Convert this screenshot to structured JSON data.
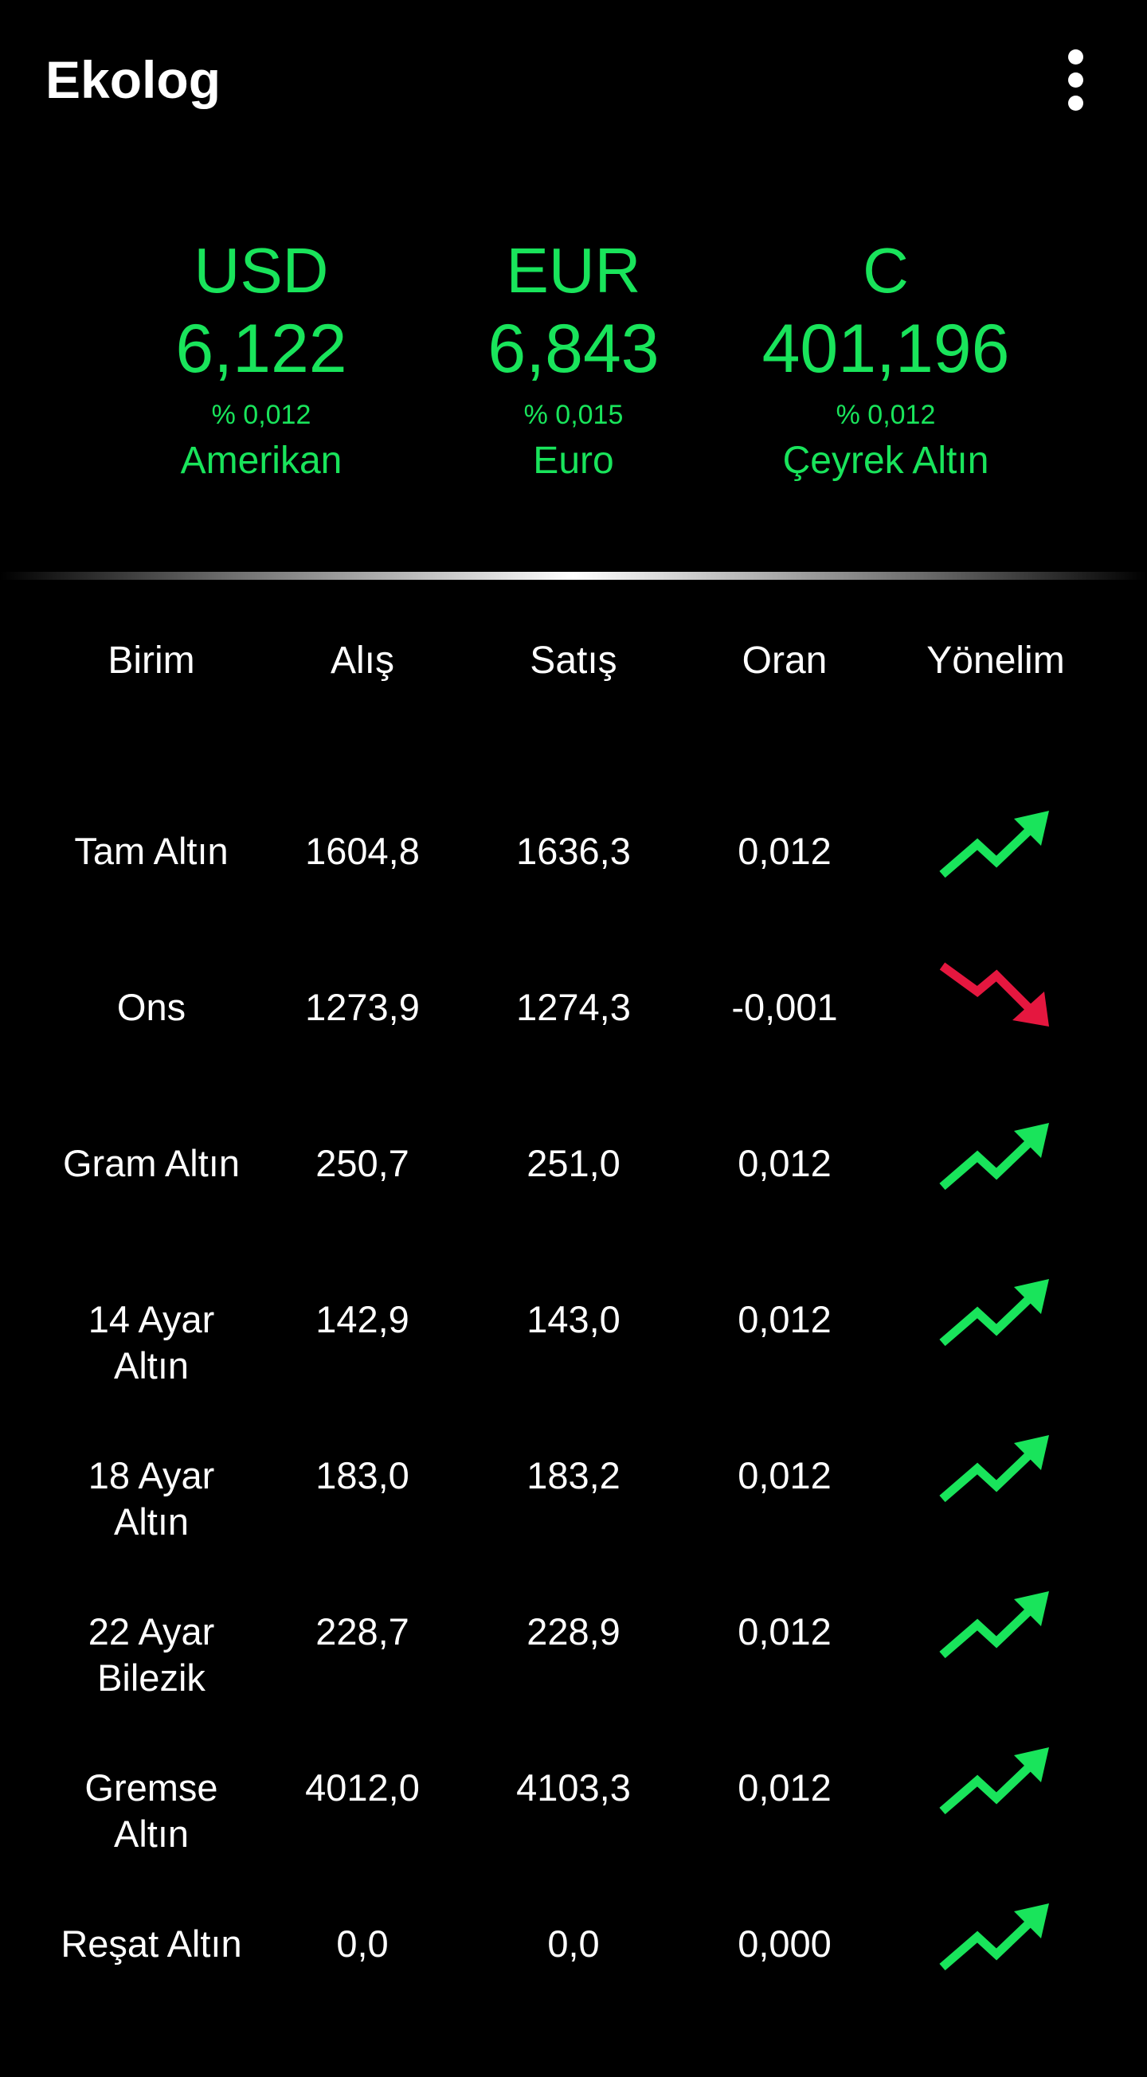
{
  "app": {
    "title": "Ekolog"
  },
  "summary": [
    {
      "code": "USD",
      "value": "6,122",
      "change": "% 0,012",
      "name": "Amerikan"
    },
    {
      "code": "EUR",
      "value": "6,843",
      "change": "% 0,015",
      "name": "Euro"
    },
    {
      "code": "C",
      "value": "401,196",
      "change": "% 0,012",
      "name": "Çeyrek Altın"
    }
  ],
  "colors": {
    "accent_green": "#19e45b",
    "down_red": "#e5173f"
  },
  "table": {
    "headers": [
      "Birim",
      "Alış",
      "Satış",
      "Oran",
      "Yönelim"
    ],
    "rows": [
      {
        "name": "Tam Altın",
        "buy": "1604,8",
        "sell": "1636,3",
        "rate": "0,012",
        "trend": "up"
      },
      {
        "name": "Ons",
        "buy": "1273,9",
        "sell": "1274,3",
        "rate": "-0,001",
        "trend": "down"
      },
      {
        "name": "Gram Altın",
        "buy": "250,7",
        "sell": "251,0",
        "rate": "0,012",
        "trend": "up"
      },
      {
        "name": "14 Ayar\nAltın",
        "buy": "142,9",
        "sell": "143,0",
        "rate": "0,012",
        "trend": "up"
      },
      {
        "name": "18 Ayar\nAltın",
        "buy": "183,0",
        "sell": "183,2",
        "rate": "0,012",
        "trend": "up"
      },
      {
        "name": "22 Ayar\nBilezik",
        "buy": "228,7",
        "sell": "228,9",
        "rate": "0,012",
        "trend": "up"
      },
      {
        "name": "Gremse\nAltın",
        "buy": "4012,0",
        "sell": "4103,3",
        "rate": "0,012",
        "trend": "up"
      },
      {
        "name": "Reşat Altın",
        "buy": "0,0",
        "sell": "0,0",
        "rate": "0,000",
        "trend": "up"
      }
    ]
  },
  "icons": {
    "menu": "overflow-menu-icon",
    "up": "trending-up-icon",
    "down": "trending-down-icon"
  }
}
